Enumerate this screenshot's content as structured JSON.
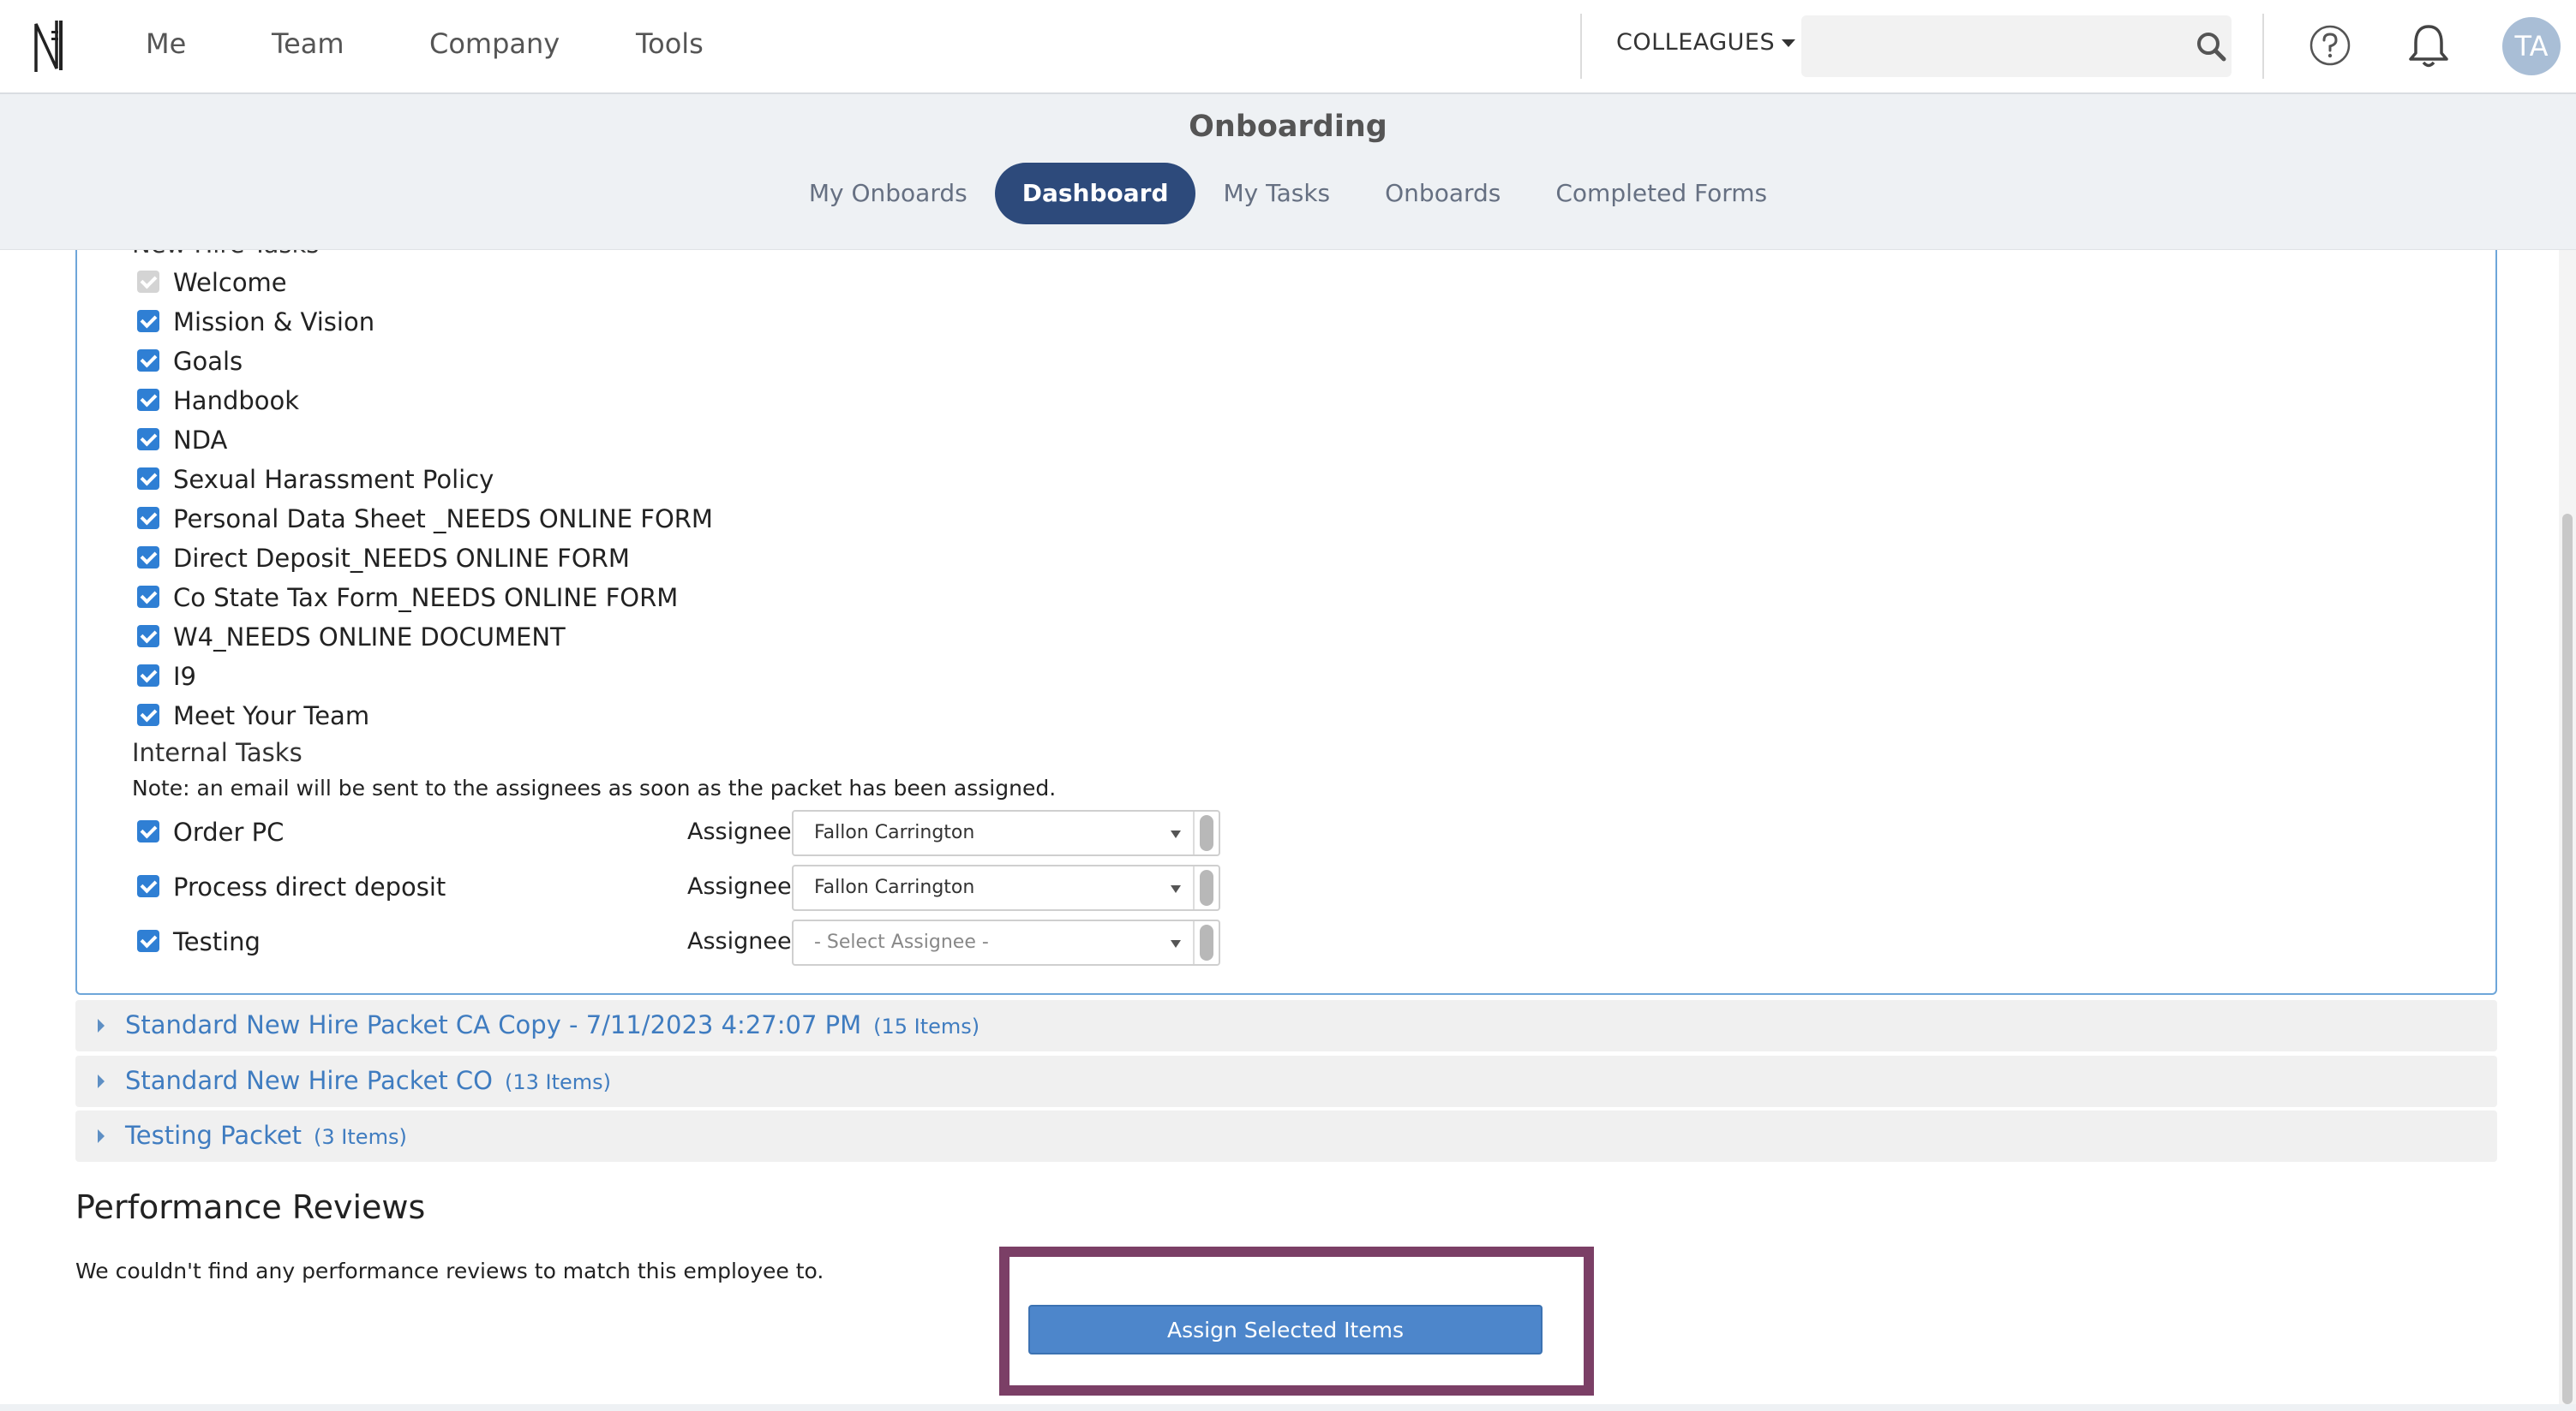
{
  "nav": {
    "items": [
      "Me",
      "Team",
      "Company",
      "Tools"
    ],
    "colleagues_label": "COLLEAGUES",
    "search_value": "",
    "avatar_initials": "TA"
  },
  "header": {
    "title": "Onboarding",
    "tabs": [
      "My Onboards",
      "Dashboard",
      "My Tasks",
      "Onboards",
      "Completed Forms"
    ],
    "active_tab": "Dashboard"
  },
  "packet": {
    "new_hire_heading": "New Hire Tasks",
    "new_hire_tasks": [
      {
        "label": "Welcome",
        "checked": true,
        "disabled": true
      },
      {
        "label": "Mission & Vision",
        "checked": true
      },
      {
        "label": "Goals",
        "checked": true
      },
      {
        "label": "Handbook",
        "checked": true
      },
      {
        "label": "NDA",
        "checked": true
      },
      {
        "label": "Sexual Harassment Policy",
        "checked": true
      },
      {
        "label": "Personal Data Sheet _NEEDS ONLINE FORM",
        "checked": true
      },
      {
        "label": "Direct Deposit_NEEDS ONLINE FORM",
        "checked": true
      },
      {
        "label": "Co State Tax Form_NEEDS ONLINE FORM",
        "checked": true
      },
      {
        "label": "W4_NEEDS ONLINE DOCUMENT",
        "checked": true
      },
      {
        "label": "I9",
        "checked": true
      },
      {
        "label": "Meet Your Team",
        "checked": true
      }
    ],
    "internal_heading": "Internal Tasks",
    "internal_note": "Note: an email will be sent to the assignees as soon as the packet has been assigned.",
    "assignee_label": "Assignee:",
    "internal_tasks": [
      {
        "label": "Order PC",
        "assignee": "Fallon Carrington",
        "checked": true
      },
      {
        "label": "Process direct deposit",
        "assignee": "Fallon Carrington",
        "checked": true
      },
      {
        "label": "Testing",
        "assignee": "- Select Assignee -",
        "checked": true
      }
    ]
  },
  "other_packets": [
    {
      "name": "Standard New Hire Packet CA Copy - 7/11/2023 4:27:07 PM",
      "count": "(15 Items)"
    },
    {
      "name": "Standard New Hire Packet CO",
      "count": "(13 Items)"
    },
    {
      "name": "Testing Packet",
      "count": "(3 Items)"
    }
  ],
  "performance": {
    "title": "Performance Reviews",
    "note": "We couldn't find any performance reviews to match this employee to."
  },
  "actions": {
    "assign_label": "Assign Selected Items"
  },
  "colors": {
    "accent": "#2d4a7b",
    "checkbox": "#2f7fd4",
    "link": "#3f7cc0",
    "highlight": "#7b3f66"
  }
}
